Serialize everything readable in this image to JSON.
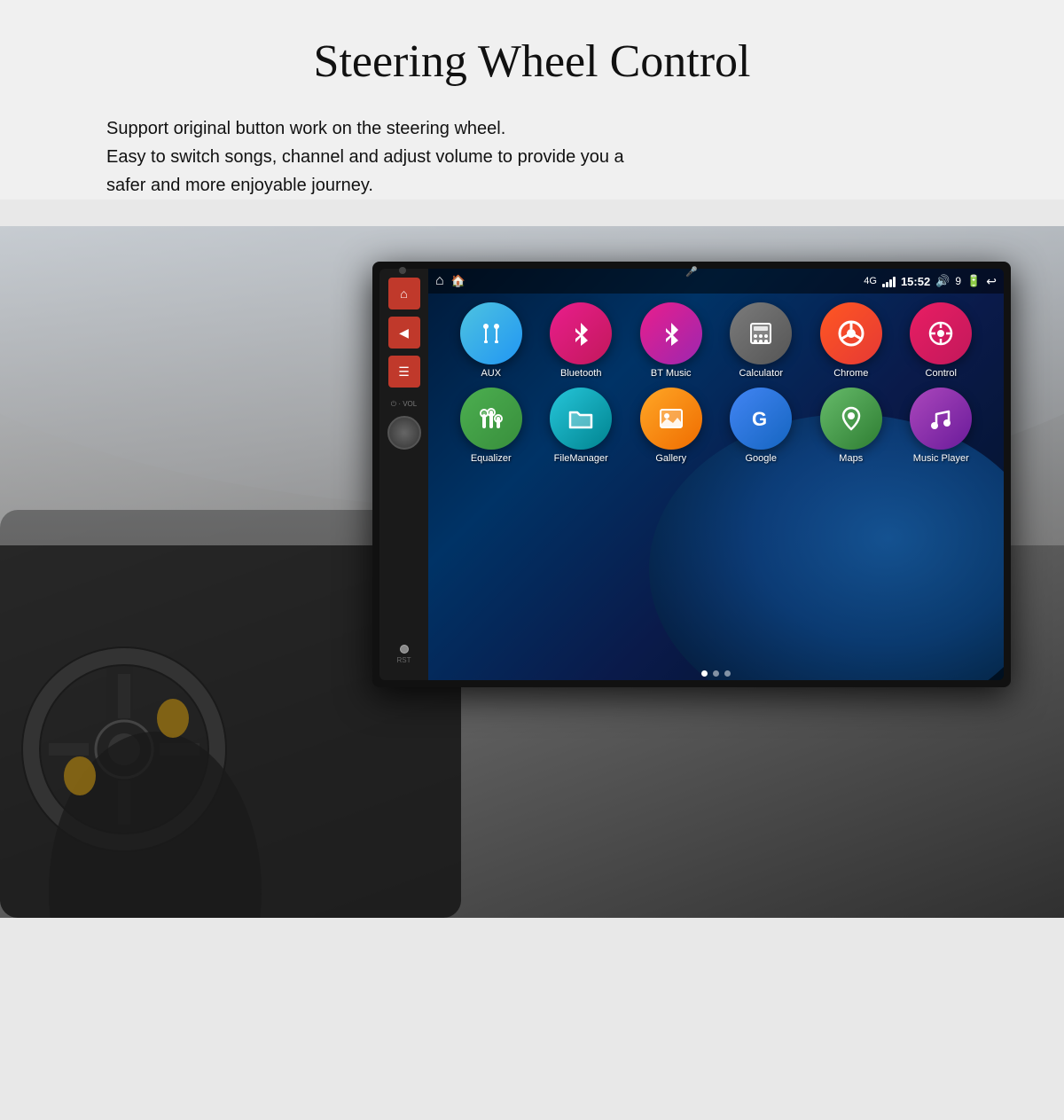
{
  "page": {
    "title": "Steering Wheel Control",
    "description_line1": "Support original button work on the steering wheel.",
    "description_line2": "Easy to switch songs, channel and adjust volume to provide you a",
    "description_line3": "safer and more enjoyable journey."
  },
  "status_bar": {
    "time": "15:52",
    "battery": "9",
    "signal": "4G"
  },
  "apps": {
    "row1": [
      {
        "id": "aux",
        "label": "AUX",
        "color_class": "app-aux",
        "icon": "🔌"
      },
      {
        "id": "bluetooth",
        "label": "Bluetooth",
        "color_class": "app-bluetooth",
        "icon": "🔵"
      },
      {
        "id": "btmusic",
        "label": "BT Music",
        "color_class": "app-btmusic",
        "icon": "🎵"
      },
      {
        "id": "calculator",
        "label": "Calculator",
        "color_class": "app-calculator",
        "icon": "🧮"
      },
      {
        "id": "chrome",
        "label": "Chrome",
        "color_class": "app-chrome",
        "icon": "⊕"
      },
      {
        "id": "control",
        "label": "Control",
        "color_class": "app-control",
        "icon": "🎮"
      }
    ],
    "row2": [
      {
        "id": "equalizer",
        "label": "Equalizer",
        "color_class": "app-equalizer",
        "icon": "🎚️"
      },
      {
        "id": "filemanager",
        "label": "FileManager",
        "color_class": "app-filemanager",
        "icon": "📁"
      },
      {
        "id": "gallery",
        "label": "Gallery",
        "color_class": "app-gallery",
        "icon": "🖼️"
      },
      {
        "id": "google",
        "label": "Google",
        "color_class": "app-google",
        "icon": "G"
      },
      {
        "id": "maps",
        "label": "Maps",
        "color_class": "app-maps",
        "icon": "📍"
      },
      {
        "id": "musicplayer",
        "label": "Music Player",
        "color_class": "app-musicplayer",
        "icon": "♪"
      }
    ]
  },
  "left_panel": {
    "buttons": [
      {
        "id": "home",
        "icon": "⌂"
      },
      {
        "id": "back",
        "icon": "◀"
      },
      {
        "id": "menu",
        "icon": "☰"
      }
    ],
    "vol_label": "⏻ · VOL",
    "rst_label": "RST"
  },
  "dots": [
    {
      "active": true
    },
    {
      "active": false
    },
    {
      "active": false
    }
  ]
}
